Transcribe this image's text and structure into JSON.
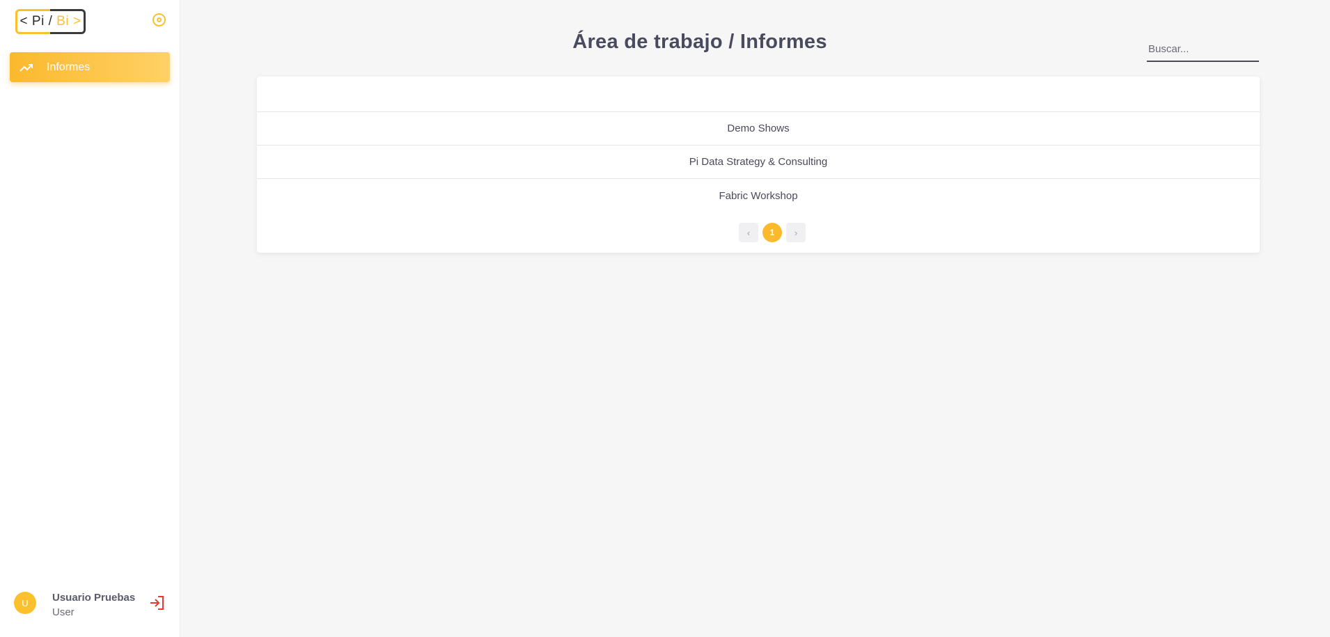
{
  "logo": {
    "lt": "<",
    "pi": "Pi",
    "slash": "/",
    "bi": "Bi",
    "gt": ">"
  },
  "sidebar": {
    "items": [
      {
        "label": "Informes",
        "icon": "trending-up-icon"
      }
    ]
  },
  "user": {
    "initial": "U",
    "name": "Usuario Pruebas",
    "role": "User"
  },
  "header": {
    "title": "Área de trabajo / Informes"
  },
  "search": {
    "placeholder": "Buscar..."
  },
  "reports": {
    "rows": [
      "Demo Shows",
      "Pi Data Strategy & Consulting",
      "Fabric Workshop"
    ]
  },
  "pagination": {
    "prev": "‹",
    "current": "1",
    "next": "›"
  },
  "colors": {
    "accent": "#fbc02d",
    "logout": "#e53935"
  }
}
